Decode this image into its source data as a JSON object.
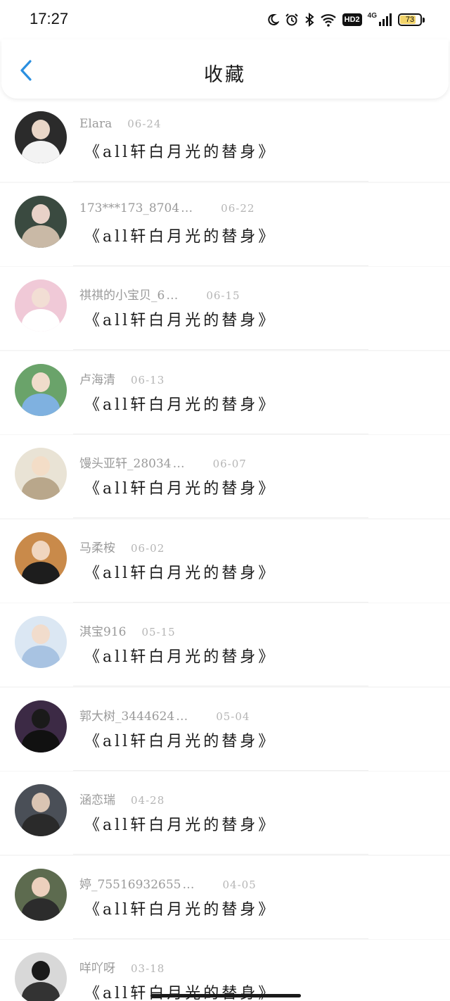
{
  "status_bar": {
    "time": "17:27",
    "network": "4G",
    "hd_badge": "HD2",
    "battery": "73"
  },
  "header": {
    "title": "收藏"
  },
  "items": [
    {
      "name": "Elara",
      "ellipsis": "",
      "date": "06-24",
      "title": "《all轩白月光的替身》",
      "avatar": {
        "bg": "#2b2b2b",
        "head": "#e9d6c7",
        "body": "#f3f3f3"
      }
    },
    {
      "name": "173***173_8704",
      "ellipsis": "…",
      "date": "06-22",
      "title": "《all轩白月光的替身》",
      "avatar": {
        "bg": "#3a4a40",
        "head": "#e8d2c8",
        "body": "#c9b9a6"
      }
    },
    {
      "name": "祺祺的小宝贝_6",
      "ellipsis": "…",
      "date": "06-15",
      "title": "《all轩白月光的替身》",
      "avatar": {
        "bg": "#f0c9d7",
        "head": "#f2ded4",
        "body": "#ffffff"
      }
    },
    {
      "name": "卢海清",
      "ellipsis": "",
      "date": "06-13",
      "title": "《all轩白月光的替身》",
      "avatar": {
        "bg": "#6aa36a",
        "head": "#f0dccb",
        "body": "#7fb1e0"
      }
    },
    {
      "name": "馒头亚轩_28034",
      "ellipsis": "…",
      "date": "06-07",
      "title": "《all轩白月光的替身》",
      "avatar": {
        "bg": "#e9e3d5",
        "head": "#f3ddc7",
        "body": "#b9a78b"
      }
    },
    {
      "name": "马柔桉",
      "ellipsis": "",
      "date": "06-02",
      "title": "《all轩白月光的替身》",
      "avatar": {
        "bg": "#c98a4a",
        "head": "#f0d6bf",
        "body": "#1d1d1d"
      }
    },
    {
      "name": "淇宝916",
      "ellipsis": "",
      "date": "05-15",
      "title": "《all轩白月光的替身》",
      "avatar": {
        "bg": "#dbe7f3",
        "head": "#f1dccc",
        "body": "#a8c3e2"
      }
    },
    {
      "name": "郭大树_3444624",
      "ellipsis": "…",
      "date": "05-04",
      "title": "《all轩白月光的替身》",
      "avatar": {
        "bg": "#3c2a45",
        "head": "#1a1a1a",
        "body": "#111111"
      }
    },
    {
      "name": "涵恋瑞",
      "ellipsis": "",
      "date": "04-28",
      "title": "《all轩白月光的替身》",
      "avatar": {
        "bg": "#4a4f57",
        "head": "#d9c4b3",
        "body": "#2a2a2a"
      }
    },
    {
      "name": "婷_75516932655",
      "ellipsis": "…",
      "date": "04-05",
      "title": "《all轩白月光的替身》",
      "avatar": {
        "bg": "#5d6b4f",
        "head": "#ecd0bd",
        "body": "#2c2c2c"
      }
    },
    {
      "name": "咩吖呀",
      "ellipsis": "",
      "date": "03-18",
      "title": "《all轩白月光的替身》",
      "avatar": {
        "bg": "#d8d8d8",
        "head": "#1a1a1a",
        "body": "#333333"
      }
    }
  ],
  "colors": {
    "accent": "#2a8fe0",
    "meta_text": "#9a9a9a",
    "title_text": "#1a1a1a"
  }
}
